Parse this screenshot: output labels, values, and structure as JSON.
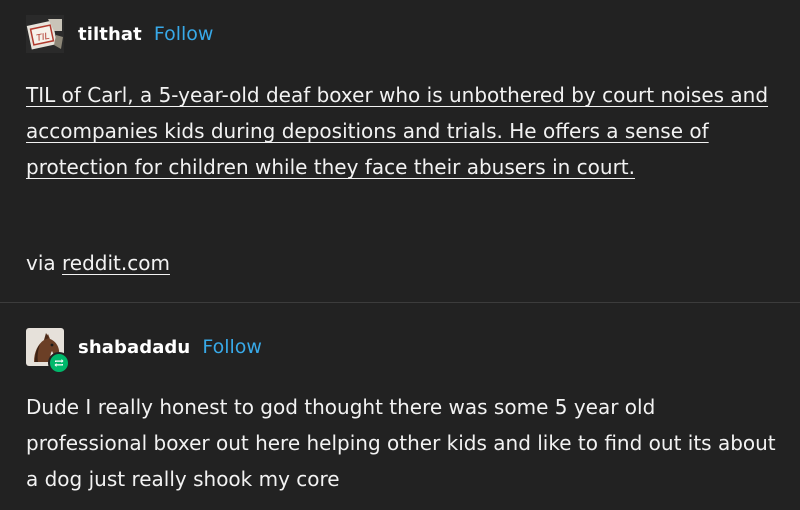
{
  "posts": [
    {
      "username": "tilthat",
      "follow_label": "Follow",
      "avatar_icon": "til-sign-avatar",
      "text": "TIL of Carl, a 5-year-old deaf boxer who is unbothered by court noises and accompanies kids during depositions and trials. He offers a sense of protection for children while they face their abusers in court.",
      "via_label": "via",
      "via_link": "reddit.com"
    },
    {
      "username": "shabadadu",
      "follow_label": "Follow",
      "avatar_icon": "horse-head-avatar",
      "badge_icon": "reblog-icon",
      "text": "Dude I really honest to god thought there was some 5 year old professional boxer out here helping other kids and like to find out its about a dog just really shook my core"
    }
  ],
  "colors": {
    "background": "#222222",
    "follow": "#38a9e8",
    "reblog_badge": "#00b86b"
  }
}
